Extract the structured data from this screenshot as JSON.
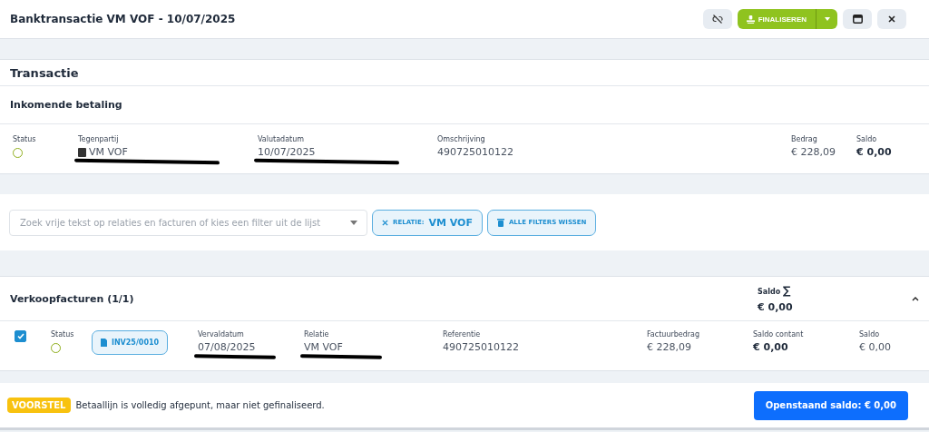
{
  "header": {
    "title": "Banktransactie VM VOF - 10/07/2025",
    "buttons": [
      {
        "kind": "unlink"
      },
      {
        "kind": "primary",
        "label": "FINALISEREN"
      },
      {
        "kind": "panel"
      },
      {
        "kind": "close"
      }
    ]
  },
  "transaction": {
    "title": "Transactie",
    "subtitle": "Inkomende betaling",
    "fields": [
      {
        "kind": "status",
        "label": "Status"
      },
      {
        "kind": "party",
        "label": "Tegenpartij",
        "value": "VM VOF",
        "redacted": true
      },
      {
        "kind": "text",
        "label": "Valutadatum",
        "value": "10/07/2025",
        "redacted": true
      },
      {
        "kind": "text",
        "label": "Omschrijving",
        "value": "490725010122"
      },
      {
        "kind": "text",
        "label": "Bedrag",
        "value": "€ 228,09"
      },
      {
        "kind": "bold",
        "label": "Saldo",
        "value": "€ 0,00"
      }
    ]
  },
  "filter": {
    "placeholder": "Zoek vrije tekst op relaties en facturen of kies een filter uit de lijst",
    "chip": {
      "label": "RELATIE:",
      "value": "VM VOF"
    },
    "clear_label": "ALLE FILTERS WISSEN"
  },
  "invoices": {
    "title": "Verkoopfacturen (1/1)",
    "sum_label": "Saldo",
    "sum_symbol": "∑",
    "sum_value": "€ 0,00",
    "expanded": true,
    "rows": [
      {
        "checked": true,
        "status_label": "Status",
        "invoice": "INV25/0010",
        "fields": [
          {
            "kind": "text",
            "label": "Vervaldatum",
            "value": "07/08/2025",
            "redacted": true
          },
          {
            "kind": "text",
            "label": "Relatie",
            "value": "VM VOF",
            "redacted": true
          },
          {
            "kind": "text",
            "label": "Referentie",
            "value": "490725010122"
          },
          {
            "kind": "text",
            "label": "Factuurbedrag",
            "value": "€ 228,09"
          },
          {
            "kind": "bold",
            "label": "Saldo contant",
            "value": "€ 0,00"
          },
          {
            "kind": "text",
            "label": "Saldo",
            "value": "€ 0,00"
          }
        ]
      }
    ]
  },
  "footer": {
    "badge": "VOORSTEL",
    "message": "Betaallijn is volledig afgepunt, maar niet gefinaliseerd.",
    "button": "Openstaand saldo: € 0,00"
  }
}
